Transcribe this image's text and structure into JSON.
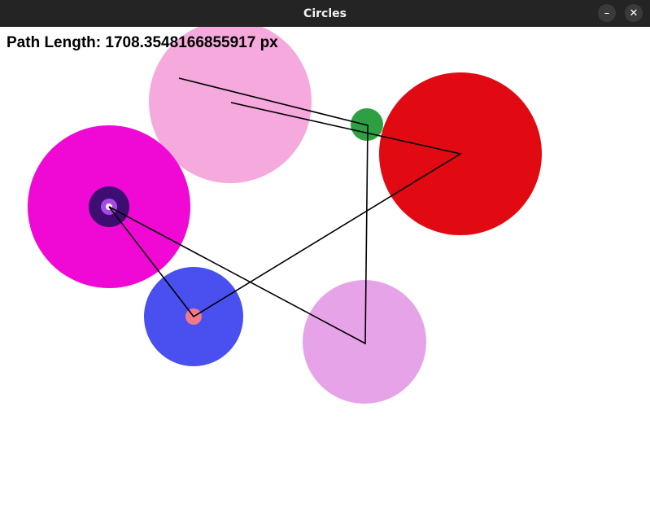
{
  "window": {
    "title": "Circles",
    "minimize_icon": "minimize-icon",
    "close_icon": "close-icon",
    "minimize_glyph": "–",
    "close_glyph": "✕"
  },
  "canvas": {
    "path_length_label": "Path Length: 1708.3548166855917 px",
    "circles": [
      {
        "name": "circle-light-pink",
        "color": "#f5a9dc"
      },
      {
        "name": "circle-magenta",
        "color": "#f008d5"
      },
      {
        "name": "circle-dark-purple",
        "color": "#3e0d72"
      },
      {
        "name": "circle-violet",
        "color": "#a64be8"
      },
      {
        "name": "circle-white-dot",
        "color": "#f4f4f4"
      },
      {
        "name": "circle-red",
        "color": "#e10a12"
      },
      {
        "name": "circle-green",
        "color": "#2ea043"
      },
      {
        "name": "circle-blue",
        "color": "#4a4ff0"
      },
      {
        "name": "circle-salmon",
        "color": "#f0798a"
      },
      {
        "name": "circle-lavender",
        "color": "#e6a3e8"
      }
    ],
    "path_color": "#000000"
  }
}
